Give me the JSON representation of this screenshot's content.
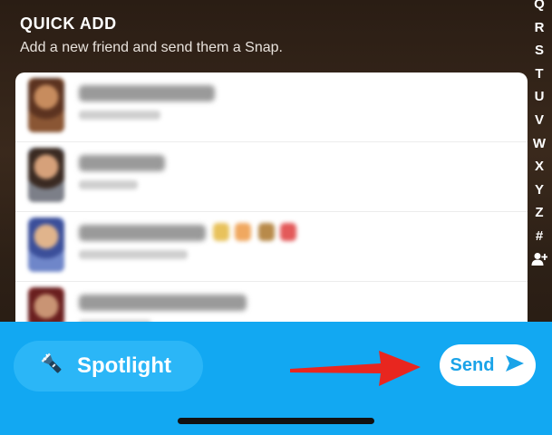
{
  "header": {
    "title": "QUICK ADD",
    "subtitle": "Add a new friend and send them a Snap."
  },
  "index_bar": {
    "letters": [
      "Q",
      "R",
      "S",
      "T",
      "U",
      "V",
      "W",
      "X",
      "Y",
      "Z",
      "#"
    ],
    "trailing_icon": "add-friend-icon"
  },
  "quick_add_list": {
    "rows": [
      {
        "name": "",
        "subtitle": "",
        "note": "blurred"
      },
      {
        "name": "",
        "subtitle": "",
        "note": "blurred"
      },
      {
        "name": "",
        "subtitle": "",
        "note": "blurred"
      },
      {
        "name": "",
        "subtitle": "",
        "note": "blurred"
      }
    ]
  },
  "bottom_bar": {
    "spotlight_label": "Spotlight",
    "spotlight_icon": "flashlight-icon",
    "send_label": "Send",
    "send_icon": "send-arrow-icon",
    "annotation_icon": "red-arrow-icon"
  },
  "colors": {
    "accent_blue": "#12a8f2",
    "spotlight_blue": "#2bb6f7",
    "send_text": "#1aa3e8",
    "annotation_red": "#e8261f"
  }
}
